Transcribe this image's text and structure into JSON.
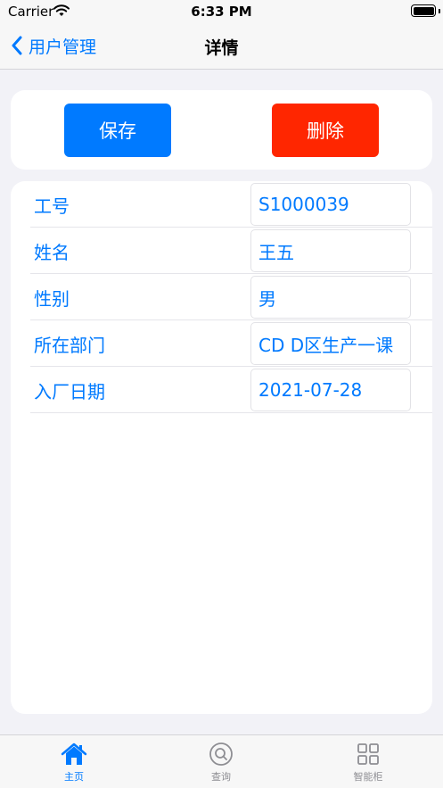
{
  "status_bar": {
    "carrier": "Carrier",
    "time": "6:33 PM"
  },
  "nav": {
    "back_label": "用户管理",
    "title": "详情"
  },
  "actions": {
    "save_label": "保存",
    "delete_label": "删除",
    "save_color": "#007aff",
    "delete_color": "#ff2600"
  },
  "form": {
    "rows": [
      {
        "label": "工号",
        "value": "S1000039"
      },
      {
        "label": "姓名",
        "value": "王五"
      },
      {
        "label": "性别",
        "value": "男"
      },
      {
        "label": "所在部门",
        "value": "CD D区生产一课"
      },
      {
        "label": "入厂日期",
        "value": "2021-07-28"
      }
    ]
  },
  "tabs": [
    {
      "label": "主页",
      "icon": "home-icon",
      "active": true
    },
    {
      "label": "查询",
      "icon": "search-icon",
      "active": false
    },
    {
      "label": "智能柜",
      "icon": "grid-icon",
      "active": false
    }
  ]
}
